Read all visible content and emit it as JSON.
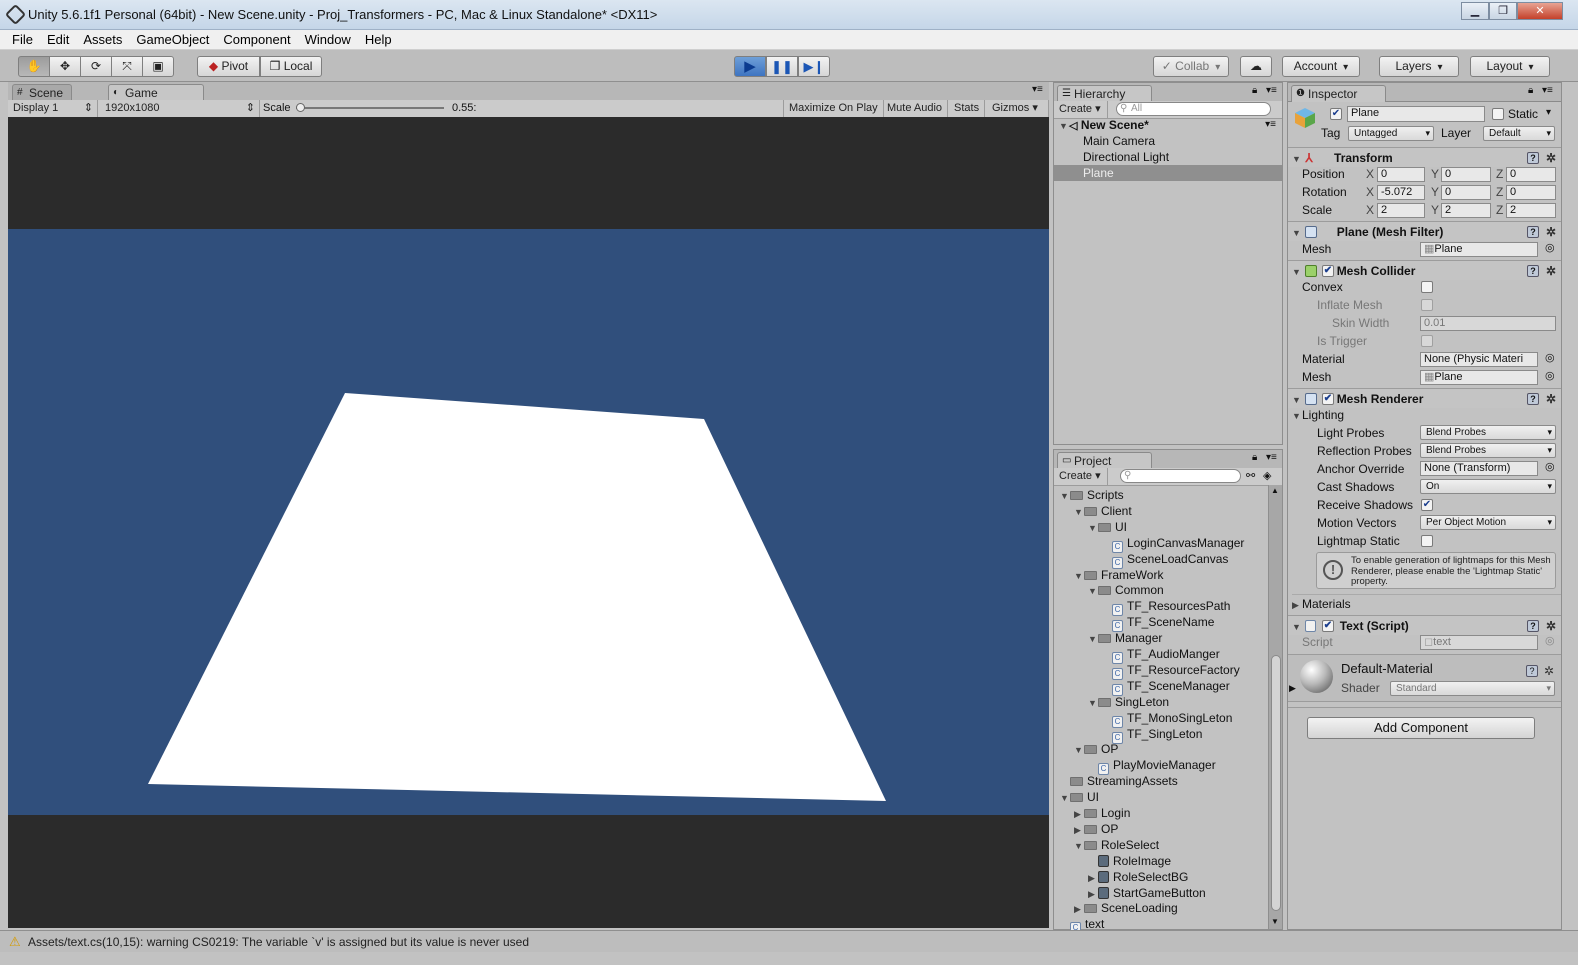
{
  "window": {
    "title": "Unity 5.6.1f1 Personal (64bit) - New Scene.unity - Proj_Transformers - PC, Mac & Linux Standalone* <DX11>",
    "btn_minimize": "▁",
    "btn_maximize": "❐",
    "btn_close": "✕"
  },
  "menu": [
    "File",
    "Edit",
    "Assets",
    "GameObject",
    "Component",
    "Window",
    "Help"
  ],
  "toolbar": {
    "pivot": "Pivot",
    "local": "Local",
    "collab": "Collab",
    "account": "Account",
    "layers": "Layers",
    "layout": "Layout"
  },
  "gameview": {
    "tab_scene": "Scene",
    "tab_game": "Game",
    "display": "Display 1",
    "resolution": "1920x1080",
    "scale_label": "Scale",
    "scale_value": "0.55:",
    "scale_level": 0.0,
    "maximize_on_play": "Maximize On Play",
    "mute_audio": "Mute Audio",
    "stats": "Stats",
    "gizmos": "Gizmos",
    "sky_color": "#304f7c",
    "plane_color": "#ffffff"
  },
  "hierarchy": {
    "tab": "Hierarchy",
    "create": "Create",
    "search_placeholder": "All",
    "scene": "New Scene*",
    "items": [
      "Main Camera",
      "Directional Light",
      "Plane"
    ],
    "selected": "Plane"
  },
  "project": {
    "tab": "Project",
    "create": "Create",
    "rows": [
      {
        "label": "Scripts",
        "kind": "folder",
        "indent": 0,
        "exp": "open"
      },
      {
        "label": "Client",
        "kind": "folder",
        "indent": 1,
        "exp": "open"
      },
      {
        "label": "UI",
        "kind": "folder",
        "indent": 2,
        "exp": "open"
      },
      {
        "label": "LoginCanvasManager",
        "kind": "cs",
        "indent": 3,
        "exp": "none"
      },
      {
        "label": "SceneLoadCanvas",
        "kind": "cs",
        "indent": 3,
        "exp": "none"
      },
      {
        "label": "FrameWork",
        "kind": "folder",
        "indent": 1,
        "exp": "open"
      },
      {
        "label": "Common",
        "kind": "folder",
        "indent": 2,
        "exp": "open"
      },
      {
        "label": "TF_ResourcesPath",
        "kind": "cs",
        "indent": 3,
        "exp": "none"
      },
      {
        "label": "TF_SceneName",
        "kind": "cs",
        "indent": 3,
        "exp": "none"
      },
      {
        "label": "Manager",
        "kind": "folder",
        "indent": 2,
        "exp": "open"
      },
      {
        "label": "TF_AudioManger",
        "kind": "cs",
        "indent": 3,
        "exp": "none"
      },
      {
        "label": "TF_ResourceFactory",
        "kind": "cs",
        "indent": 3,
        "exp": "none"
      },
      {
        "label": "TF_SceneManager",
        "kind": "cs",
        "indent": 3,
        "exp": "none"
      },
      {
        "label": "SingLeton",
        "kind": "folder",
        "indent": 2,
        "exp": "open"
      },
      {
        "label": "TF_MonoSingLeton",
        "kind": "cs",
        "indent": 3,
        "exp": "none"
      },
      {
        "label": "TF_SingLeton",
        "kind": "cs",
        "indent": 3,
        "exp": "none"
      },
      {
        "label": "OP",
        "kind": "folder",
        "indent": 1,
        "exp": "open"
      },
      {
        "label": "PlayMovieManager",
        "kind": "cs",
        "indent": 2,
        "exp": "none"
      },
      {
        "label": "StreamingAssets",
        "kind": "folder",
        "indent": 0,
        "exp": "none"
      },
      {
        "label": "UI",
        "kind": "folder",
        "indent": 0,
        "exp": "open"
      },
      {
        "label": "Login",
        "kind": "folder",
        "indent": 1,
        "exp": "closed"
      },
      {
        "label": "OP",
        "kind": "folder",
        "indent": 1,
        "exp": "closed"
      },
      {
        "label": "RoleSelect",
        "kind": "folder",
        "indent": 1,
        "exp": "open"
      },
      {
        "label": "RoleImage",
        "kind": "image",
        "indent": 2,
        "exp": "none"
      },
      {
        "label": "RoleSelectBG",
        "kind": "image",
        "indent": 2,
        "exp": "closed"
      },
      {
        "label": "StartGameButton",
        "kind": "image",
        "indent": 2,
        "exp": "closed"
      },
      {
        "label": "SceneLoading",
        "kind": "folder",
        "indent": 1,
        "exp": "closed"
      },
      {
        "label": "text",
        "kind": "cs",
        "indent": 0,
        "exp": "none"
      }
    ]
  },
  "inspector": {
    "tab": "Inspector",
    "object_name": "Plane",
    "static_label": "Static",
    "tag_label": "Tag",
    "tag_value": "Untagged",
    "layer_label": "Layer",
    "layer_value": "Default",
    "transform": {
      "title": "Transform",
      "position_label": "Position",
      "rotation_label": "Rotation",
      "scale_label": "Scale",
      "position": [
        "0",
        "0",
        "0"
      ],
      "rotation": [
        "-5.072",
        "0",
        "0"
      ],
      "scale": [
        "2",
        "2",
        "2"
      ],
      "x": "X",
      "y": "Y",
      "z": "Z"
    },
    "mesh_filter": {
      "title": "Plane (Mesh Filter)",
      "mesh_label": "Mesh",
      "mesh_value": "Plane"
    },
    "mesh_collider": {
      "title": "Mesh Collider",
      "convex": "Convex",
      "inflate_mesh": "Inflate Mesh",
      "skin_width": "Skin Width",
      "skin_width_value": "0.01",
      "is_trigger": "Is Trigger",
      "material_label": "Material",
      "material_value": "None (Physic Materi",
      "mesh_label": "Mesh",
      "mesh_value": "Plane"
    },
    "mesh_renderer": {
      "title": "Mesh Renderer",
      "lighting": "Lighting",
      "light_probes": "Light Probes",
      "light_probes_value": "Blend Probes",
      "reflection_probes": "Reflection Probes",
      "reflection_probes_value": "Blend Probes",
      "anchor_override": "Anchor Override",
      "anchor_override_value": "None (Transform)",
      "cast_shadows": "Cast Shadows",
      "cast_shadows_value": "On",
      "receive_shadows": "Receive Shadows",
      "motion_vectors": "Motion Vectors",
      "motion_vectors_value": "Per Object Motion",
      "lightmap_static": "Lightmap Static",
      "help_text": "To enable generation of lightmaps for this Mesh Renderer, please enable the 'Lightmap Static' property.",
      "materials": "Materials"
    },
    "text_script": {
      "title": "Text (Script)",
      "script_label": "Script",
      "script_value": "text"
    },
    "material": {
      "name": "Default-Material",
      "shader_label": "Shader",
      "shader_value": "Standard"
    },
    "add_component": "Add Component"
  },
  "status": {
    "message": "Assets/text.cs(10,15): warning CS0219: The variable `v' is assigned but its value is never used"
  }
}
